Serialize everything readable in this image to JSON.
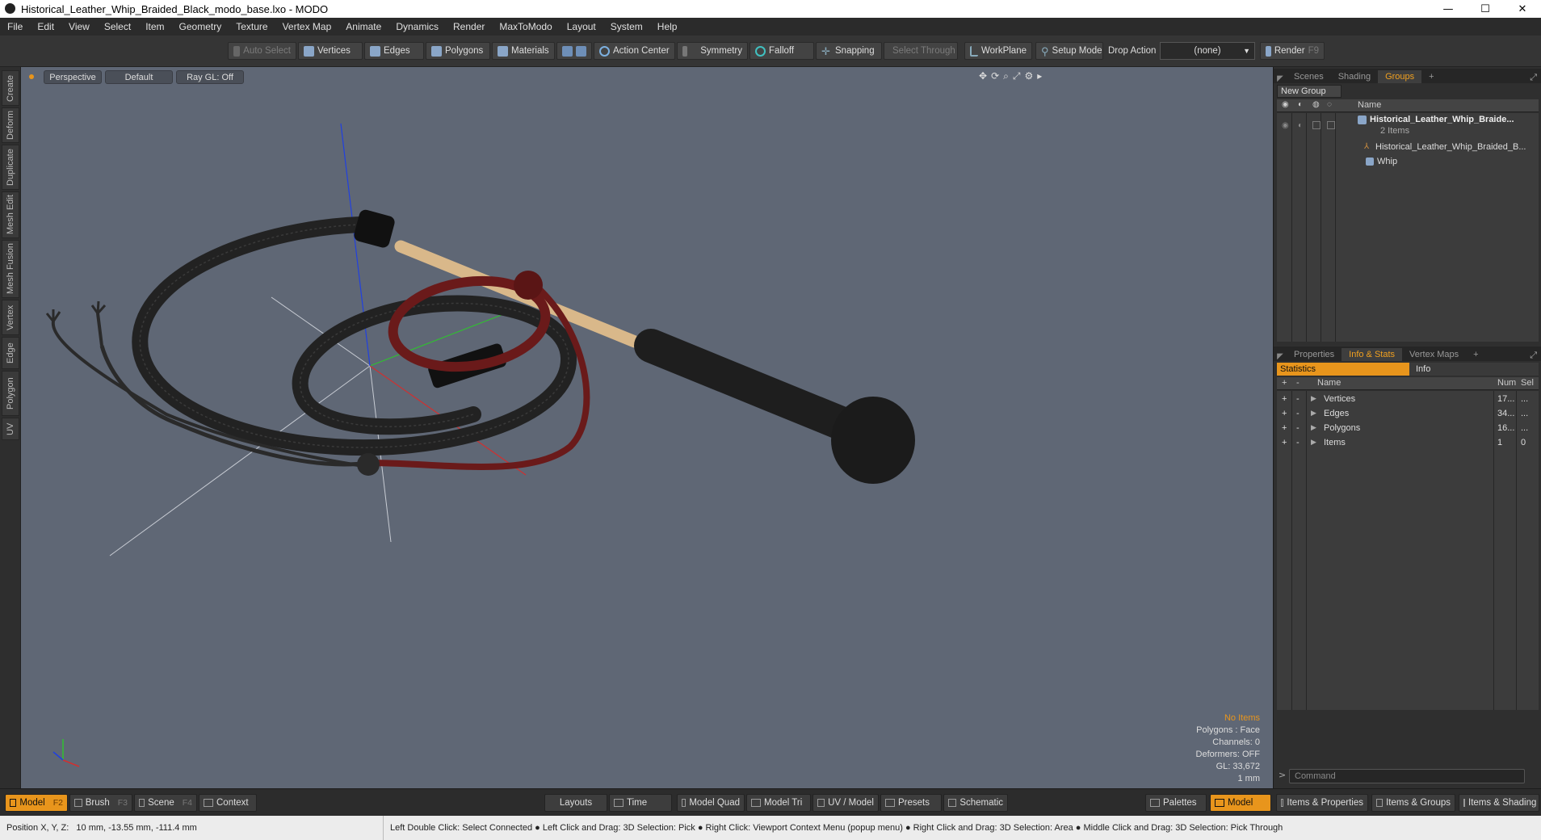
{
  "window": {
    "title": "Historical_Leather_Whip_Braided_Black_modo_base.lxo - MODO",
    "controls": [
      "—",
      "☐",
      "✕"
    ]
  },
  "menu": [
    "File",
    "Edit",
    "View",
    "Select",
    "Item",
    "Geometry",
    "Texture",
    "Vertex Map",
    "Animate",
    "Dynamics",
    "Render",
    "MaxToModo",
    "Layout",
    "System",
    "Help"
  ],
  "toolbar": {
    "auto_select": "Auto Select",
    "vertices": "Vertices",
    "edges": "Edges",
    "polygons": "Polygons",
    "materials": "Materials",
    "action_center": "Action Center",
    "symmetry": "Symmetry",
    "falloff": "Falloff",
    "snapping": "Snapping",
    "select_through": "Select Through",
    "workplane": "WorkPlane",
    "setup_mode": "Setup Mode",
    "drop_action_label": "Drop Action",
    "drop_action_value": "(none)",
    "render": "Render",
    "render_key": "F9"
  },
  "left_tabs": [
    "Create",
    "Deform",
    "Duplicate",
    "Mesh Edit",
    "Mesh Fusion",
    "Vertex",
    "Edge",
    "Polygon",
    "UV"
  ],
  "viewport": {
    "view": "Perspective",
    "shading": "Default",
    "raygl": "Ray GL: Off",
    "info": {
      "selection": "No Items",
      "polygons": "Polygons : Face",
      "channels": "Channels: 0",
      "deformers": "Deformers: OFF",
      "gl": "GL: 33,672",
      "unit": "1 mm"
    },
    "axis_colors": {
      "x": "#d03030",
      "y": "#30c030",
      "z": "#2040e0"
    }
  },
  "scene_panel": {
    "tabs": [
      "Scenes",
      "Shading",
      "Groups"
    ],
    "active_tab": "Groups",
    "new_group": "New Group",
    "column_name": "Name",
    "root_item": "Historical_Leather_Whip_Braide...",
    "root_count": "2 Items",
    "children": [
      "Historical_Leather_Whip_Braided_B...",
      "Whip"
    ]
  },
  "stats_panel": {
    "tabs": [
      "Properties",
      "Info & Stats",
      "Vertex Maps"
    ],
    "active_tab": "Info & Stats",
    "subtabs": [
      "Statistics",
      "Info"
    ],
    "columns": [
      "Name",
      "Num",
      "Sel"
    ],
    "rows": [
      {
        "name": "Vertices",
        "num": "17...",
        "sel": "..."
      },
      {
        "name": "Edges",
        "num": "34...",
        "sel": "..."
      },
      {
        "name": "Polygons",
        "num": "16...",
        "sel": "..."
      },
      {
        "name": "Items",
        "num": "1",
        "sel": "0"
      }
    ],
    "command_placeholder": "Command"
  },
  "bottom_bar": {
    "model": "Model",
    "model_key": "F2",
    "brush": "Brush",
    "brush_key": "F3",
    "scene": "Scene",
    "scene_key": "F4",
    "context": "Context",
    "layouts": "Layouts",
    "time": "Time",
    "model_quad": "Model Quad",
    "model_tri": "Model Tri",
    "uv_model": "UV / Model",
    "presets": "Presets",
    "schematic": "Schematic",
    "palettes": "Palettes",
    "model_right": "Model",
    "items_properties": "Items & Properties",
    "items_groups": "Items & Groups",
    "items_shading": "Items & Shading"
  },
  "status": {
    "position": "Position X, Y, Z:   10 mm, -13.55 mm, -111.4 mm",
    "hints": "Left Double Click: Select Connected ● Left Click and Drag: 3D Selection: Pick ● Right Click: Viewport Context Menu (popup menu) ● Right Click and Drag: 3D Selection: Area ● Middle Click and Drag: 3D Selection: Pick Through"
  }
}
